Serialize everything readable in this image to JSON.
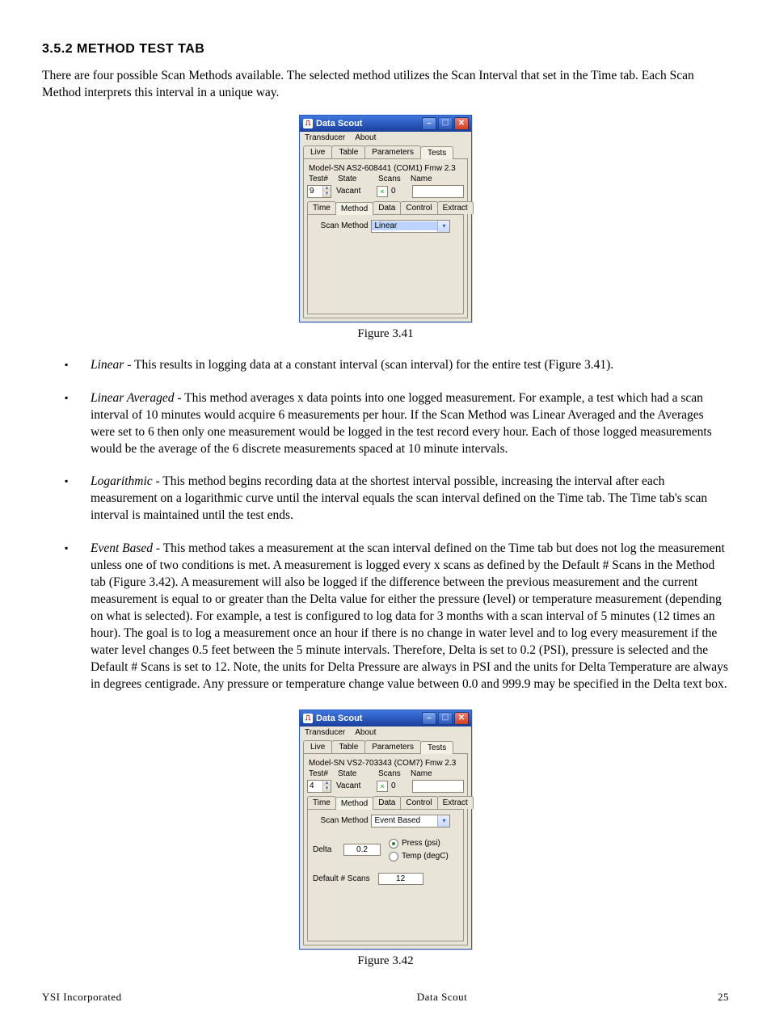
{
  "doc": {
    "heading": "3.5.2 METHOD TEST TAB",
    "intro": "There are four possible Scan Methods available.  The selected method utilizes the Scan Interval that set in the Time tab. Each Scan Method interprets this interval in a unique way.",
    "fig1_caption": "Figure 3.41",
    "fig2_caption": "Figure 3.42",
    "bullets": {
      "linear_term": "Linear",
      "linear_text": " - This results in logging data at a constant interval (scan interval) for the entire test (Figure 3.41).",
      "linavg_term": "Linear Averaged",
      "linavg_text": " - This method averages x data points into one logged measurement. For example, a test which had a scan interval of 10 minutes would acquire 6 measurements per hour. If the Scan Method was Linear Averaged and the Averages were set to 6 then only one measurement would be logged in the test record every hour. Each of those logged measurements would be the average of the 6 discrete measurements spaced at 10 minute intervals.",
      "log_term": "Logarithmic",
      "log_text": " - This method begins recording data at the shortest interval possible, increasing the interval after each measurement on a logarithmic curve until the interval equals the scan interval defined on the Time tab. The Time tab's scan interval is maintained until the test ends.",
      "evt_term": "Event Based",
      "evt_text": " - This method takes a measurement at the scan interval defined on the Time tab but does not log the measurement unless one of two conditions is met.  A measurement is logged every x scans as defined by the Default # Scans in the Method tab (Figure 3.42). A measurement will also be logged if the difference between the previous measurement and the current measurement is equal to or greater than the Delta value for either the pressure (level) or temperature measurement (depending on what is selected).  For example, a test is configured to log data for 3 months with a scan interval of 5 minutes (12 times an hour). The goal is to log a measurement once an hour if there is no change in water level and to log every measurement if the water level changes 0.5 feet between the 5 minute intervals. Therefore, Delta is set to 0.2 (PSI), pressure is selected and the Default # Scans is set to 12. Note, the units for Delta Pressure are always in PSI and the units for Delta Temperature are always in degrees centigrade. Any pressure or temperature change value between 0.0 and 999.9 may be specified in the Delta text box."
    },
    "footer": {
      "left": "YSI Incorporated",
      "center": "Data Scout",
      "right": "25"
    }
  },
  "app": {
    "title": "Data Scout",
    "menus": {
      "transducer": "Transducer",
      "about": "About"
    },
    "top_tabs": {
      "live": "Live",
      "table": "Table",
      "params": "Parameters",
      "tests": "Tests"
    },
    "status_labels": {
      "test": "Test#",
      "state": "State",
      "scans": "Scans",
      "name": "Name"
    },
    "sub_tabs": {
      "time": "Time",
      "method": "Method",
      "data": "Data",
      "control": "Control",
      "extract": "Extract"
    },
    "scan_method_label": "Scan Method",
    "delta_label": "Delta",
    "press_label": "Press (psi)",
    "temp_label": "Temp (degC)",
    "default_scans_label": "Default # Scans"
  },
  "fig1": {
    "model": "Model-SN AS2-608441 (COM1) Fmw 2.3",
    "test_no": "9",
    "state": "Vacant",
    "scans": "0",
    "name": "",
    "scan_method": "Linear"
  },
  "fig2": {
    "model": "Model-SN VS2-703343 (COM7) Fmw 2.3",
    "test_no": "4",
    "state": "Vacant",
    "scans": "0",
    "name": "",
    "scan_method": "Event Based",
    "delta": "0.2",
    "radio_press": true,
    "radio_temp": false,
    "default_scans": "12"
  }
}
